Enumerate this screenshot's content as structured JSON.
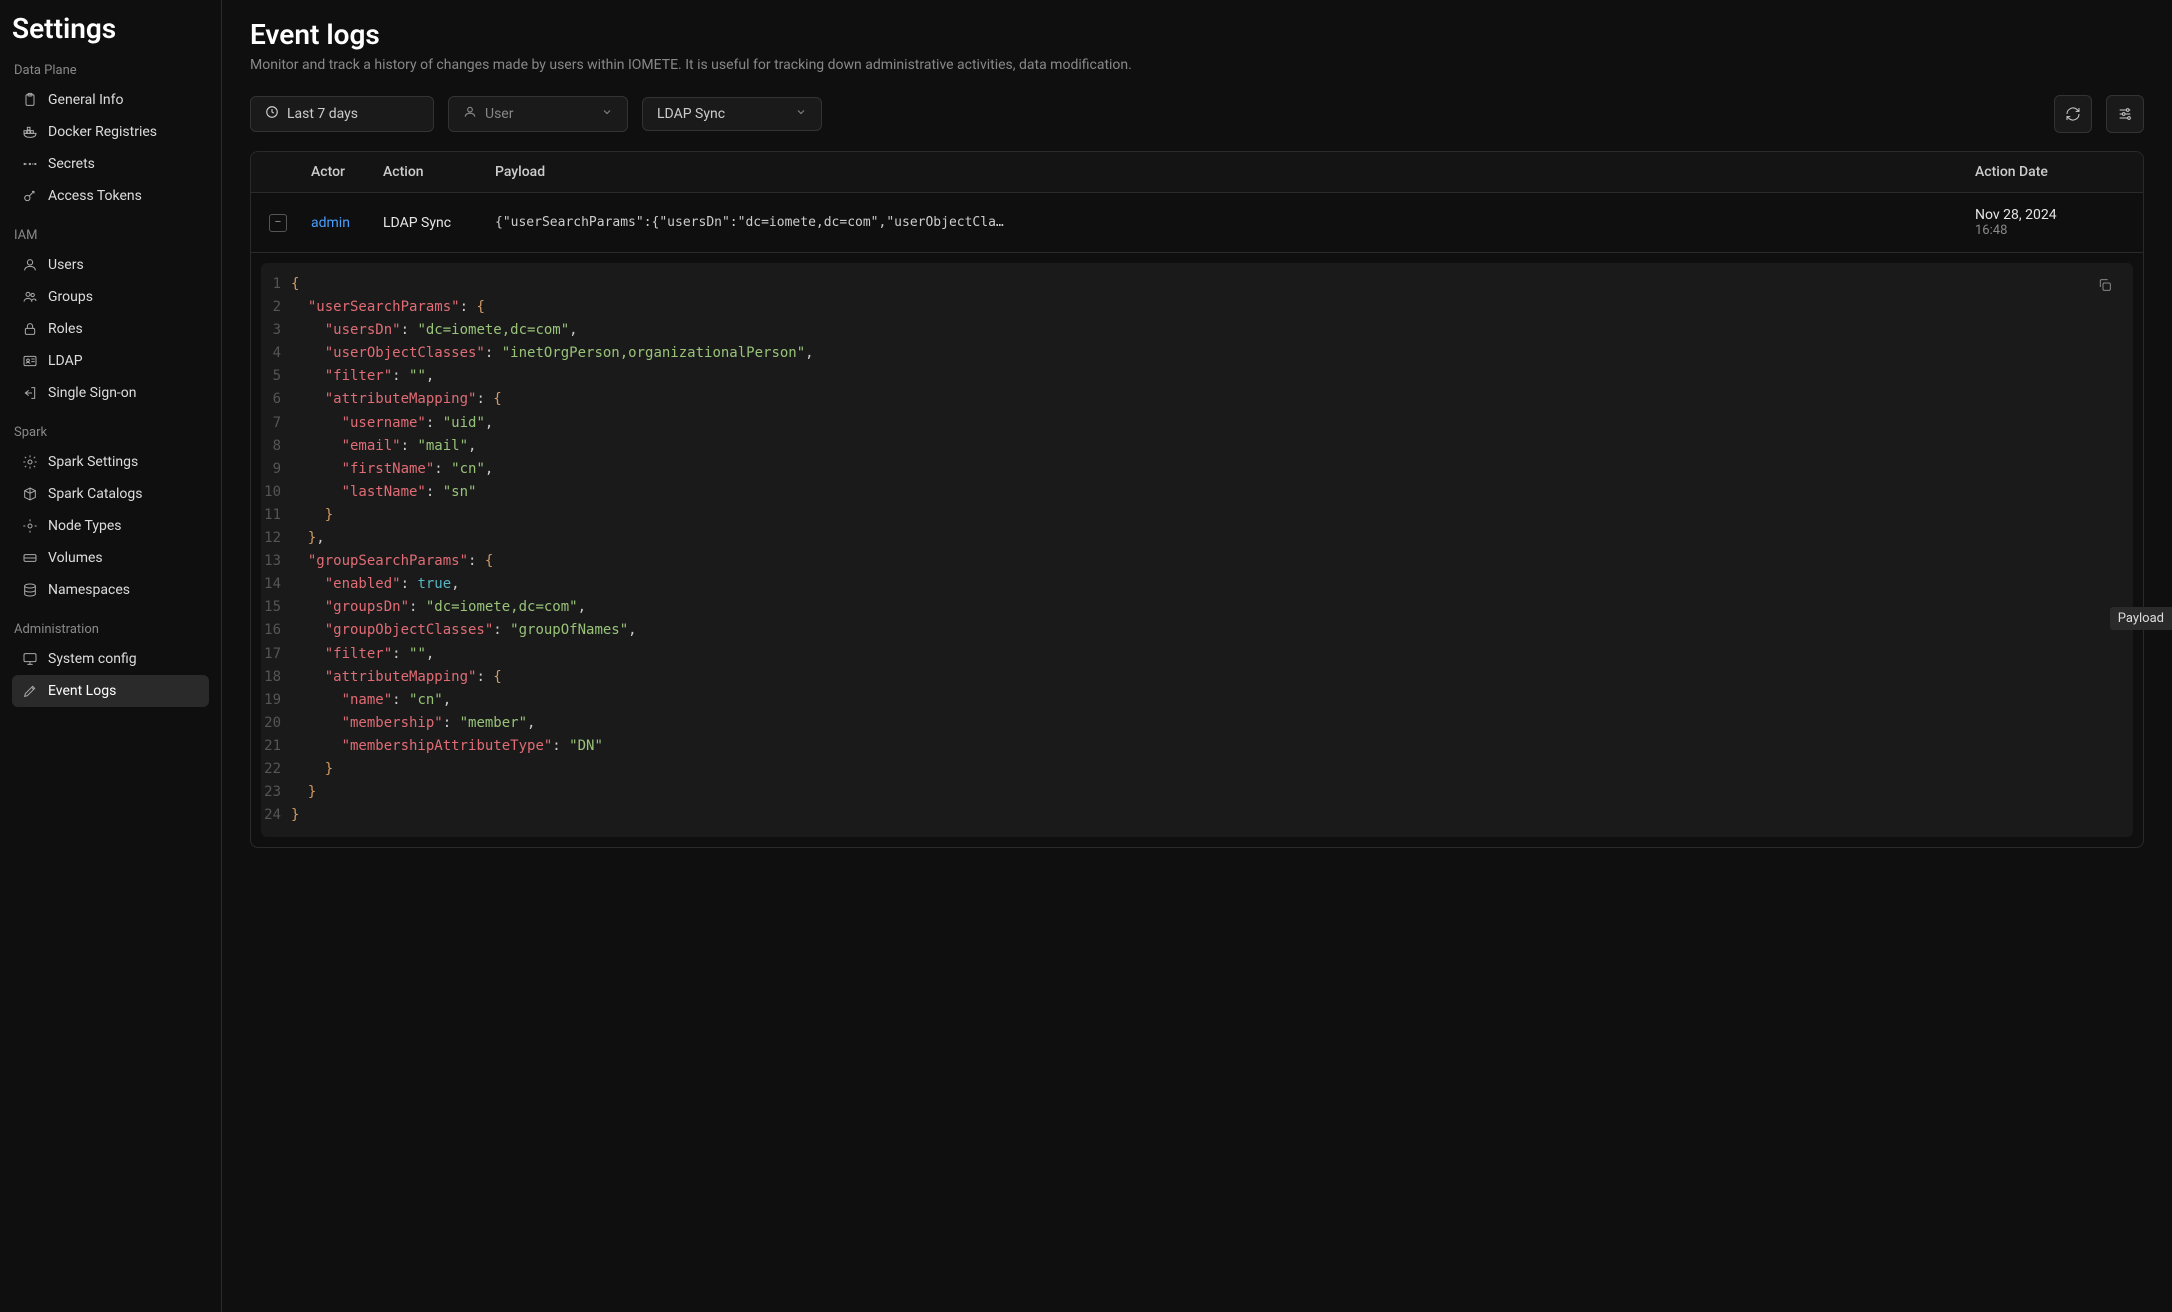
{
  "sidebar": {
    "title": "Settings",
    "sections": [
      {
        "label": "Data Plane",
        "items": [
          {
            "icon": "clipboard",
            "label": "General Info"
          },
          {
            "icon": "docker",
            "label": "Docker Registries"
          },
          {
            "icon": "secrets",
            "label": "Secrets"
          },
          {
            "icon": "key",
            "label": "Access Tokens"
          }
        ]
      },
      {
        "label": "IAM",
        "items": [
          {
            "icon": "user",
            "label": "Users"
          },
          {
            "icon": "group",
            "label": "Groups"
          },
          {
            "icon": "lock",
            "label": "Roles"
          },
          {
            "icon": "idcard",
            "label": "LDAP"
          },
          {
            "icon": "exit",
            "label": "Single Sign-on"
          }
        ]
      },
      {
        "label": "Spark",
        "items": [
          {
            "icon": "gear",
            "label": "Spark Settings"
          },
          {
            "icon": "cube",
            "label": "Spark Catalogs"
          },
          {
            "icon": "gear2",
            "label": "Node Types"
          },
          {
            "icon": "volume",
            "label": "Volumes"
          },
          {
            "icon": "database",
            "label": "Namespaces"
          }
        ]
      },
      {
        "label": "Administration",
        "items": [
          {
            "icon": "monitor",
            "label": "System config"
          },
          {
            "icon": "pencil",
            "label": "Event Logs",
            "active": true
          }
        ]
      }
    ]
  },
  "page": {
    "title": "Event logs",
    "subtitle": "Monitor and track a history of changes made by users within IOMETE. It is useful for tracking down administrative activities, data modification."
  },
  "toolbar": {
    "dateRange": "Last 7 days",
    "userPlaceholder": "User",
    "typeFilter": "LDAP Sync"
  },
  "table": {
    "headers": {
      "actor": "Actor",
      "action": "Action",
      "payload": "Payload",
      "date": "Action Date"
    },
    "rows": [
      {
        "actor": "admin",
        "action": "LDAP Sync",
        "payloadPreview": "{\"userSearchParams\":{\"usersDn\":\"dc=iomete,dc=com\",\"userObjectCla…",
        "date": "Nov 28, 2024",
        "time": "16:48",
        "expanded": true
      }
    ]
  },
  "payloadJson": {
    "userSearchParams": {
      "usersDn": "dc=iomete,dc=com",
      "userObjectClasses": "inetOrgPerson,organizationalPerson",
      "filter": "",
      "attributeMapping": {
        "username": "uid",
        "email": "mail",
        "firstName": "cn",
        "lastName": "sn"
      }
    },
    "groupSearchParams": {
      "enabled": true,
      "groupsDn": "dc=iomete,dc=com",
      "groupObjectClasses": "groupOfNames",
      "filter": "",
      "attributeMapping": {
        "name": "cn",
        "membership": "member",
        "membershipAttributeType": "DN"
      }
    }
  },
  "codeLines": [
    [
      [
        "{",
        "brace"
      ]
    ],
    [
      [
        "  ",
        "punc"
      ],
      [
        "\"userSearchParams\"",
        "key"
      ],
      [
        ": ",
        "punc"
      ],
      [
        "{",
        "brace"
      ]
    ],
    [
      [
        "    ",
        "punc"
      ],
      [
        "\"usersDn\"",
        "key"
      ],
      [
        ": ",
        "punc"
      ],
      [
        "\"dc=iomete,dc=com\"",
        "str"
      ],
      [
        ",",
        "punc"
      ]
    ],
    [
      [
        "    ",
        "punc"
      ],
      [
        "\"userObjectClasses\"",
        "key"
      ],
      [
        ": ",
        "punc"
      ],
      [
        "\"inetOrgPerson,organizationalPerson\"",
        "str"
      ],
      [
        ",",
        "punc"
      ]
    ],
    [
      [
        "    ",
        "punc"
      ],
      [
        "\"filter\"",
        "key"
      ],
      [
        ": ",
        "punc"
      ],
      [
        "\"\"",
        "str"
      ],
      [
        ",",
        "punc"
      ]
    ],
    [
      [
        "    ",
        "punc"
      ],
      [
        "\"attributeMapping\"",
        "key"
      ],
      [
        ": ",
        "punc"
      ],
      [
        "{",
        "brace"
      ]
    ],
    [
      [
        "      ",
        "punc"
      ],
      [
        "\"username\"",
        "key"
      ],
      [
        ": ",
        "punc"
      ],
      [
        "\"uid\"",
        "str"
      ],
      [
        ",",
        "punc"
      ]
    ],
    [
      [
        "      ",
        "punc"
      ],
      [
        "\"email\"",
        "key"
      ],
      [
        ": ",
        "punc"
      ],
      [
        "\"mail\"",
        "str"
      ],
      [
        ",",
        "punc"
      ]
    ],
    [
      [
        "      ",
        "punc"
      ],
      [
        "\"firstName\"",
        "key"
      ],
      [
        ": ",
        "punc"
      ],
      [
        "\"cn\"",
        "str"
      ],
      [
        ",",
        "punc"
      ]
    ],
    [
      [
        "      ",
        "punc"
      ],
      [
        "\"lastName\"",
        "key"
      ],
      [
        ": ",
        "punc"
      ],
      [
        "\"sn\"",
        "str"
      ]
    ],
    [
      [
        "    ",
        "punc"
      ],
      [
        "}",
        "brace"
      ]
    ],
    [
      [
        "  ",
        "punc"
      ],
      [
        "}",
        "brace"
      ],
      [
        ",",
        "punc"
      ]
    ],
    [
      [
        "  ",
        "punc"
      ],
      [
        "\"groupSearchParams\"",
        "key"
      ],
      [
        ": ",
        "punc"
      ],
      [
        "{",
        "brace"
      ]
    ],
    [
      [
        "    ",
        "punc"
      ],
      [
        "\"enabled\"",
        "key"
      ],
      [
        ": ",
        "punc"
      ],
      [
        "true",
        "bool"
      ],
      [
        ",",
        "punc"
      ]
    ],
    [
      [
        "    ",
        "punc"
      ],
      [
        "\"groupsDn\"",
        "key"
      ],
      [
        ": ",
        "punc"
      ],
      [
        "\"dc=iomete,dc=com\"",
        "str"
      ],
      [
        ",",
        "punc"
      ]
    ],
    [
      [
        "    ",
        "punc"
      ],
      [
        "\"groupObjectClasses\"",
        "key"
      ],
      [
        ": ",
        "punc"
      ],
      [
        "\"groupOfNames\"",
        "str"
      ],
      [
        ",",
        "punc"
      ]
    ],
    [
      [
        "    ",
        "punc"
      ],
      [
        "\"filter\"",
        "key"
      ],
      [
        ": ",
        "punc"
      ],
      [
        "\"\"",
        "str"
      ],
      [
        ",",
        "punc"
      ]
    ],
    [
      [
        "    ",
        "punc"
      ],
      [
        "\"attributeMapping\"",
        "key"
      ],
      [
        ": ",
        "punc"
      ],
      [
        "{",
        "brace"
      ]
    ],
    [
      [
        "      ",
        "punc"
      ],
      [
        "\"name\"",
        "key"
      ],
      [
        ": ",
        "punc"
      ],
      [
        "\"cn\"",
        "str"
      ],
      [
        ",",
        "punc"
      ]
    ],
    [
      [
        "      ",
        "punc"
      ],
      [
        "\"membership\"",
        "key"
      ],
      [
        ": ",
        "punc"
      ],
      [
        "\"member\"",
        "str"
      ],
      [
        ",",
        "punc"
      ]
    ],
    [
      [
        "      ",
        "punc"
      ],
      [
        "\"membershipAttributeType\"",
        "key"
      ],
      [
        ": ",
        "punc"
      ],
      [
        "\"DN\"",
        "str"
      ]
    ],
    [
      [
        "    ",
        "punc"
      ],
      [
        "}",
        "brace"
      ]
    ],
    [
      [
        "  ",
        "punc"
      ],
      [
        "}",
        "brace"
      ]
    ],
    [
      [
        "}",
        "brace"
      ]
    ]
  ],
  "tooltip": "Payload"
}
